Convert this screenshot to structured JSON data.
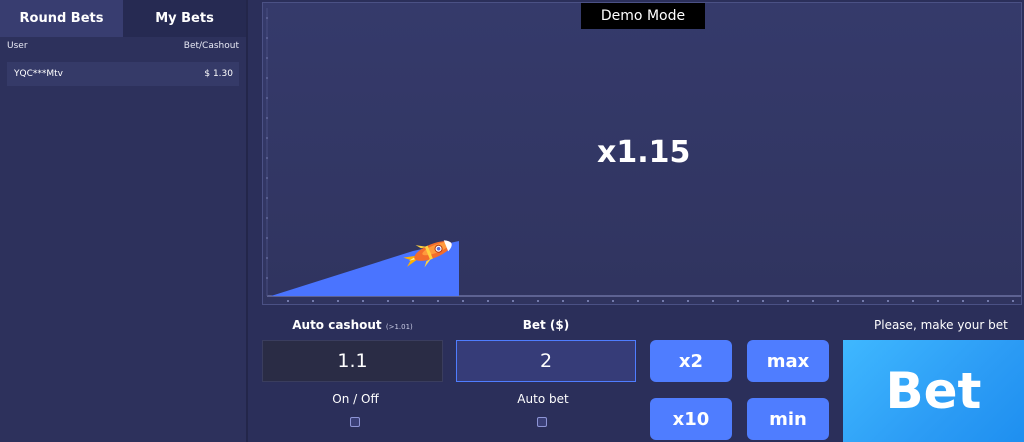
{
  "tabs": [
    {
      "label": "Round Bets",
      "active": true
    },
    {
      "label": "My Bets",
      "active": false
    }
  ],
  "bets_list": {
    "col_user": "User",
    "col_bet": "Bet/Cashout",
    "rows": [
      {
        "user": "YQC***Mtv",
        "amount": "$ 1.30"
      }
    ]
  },
  "game": {
    "demo_badge": "Demo Mode",
    "multiplier": "x1.15"
  },
  "controls": {
    "auto_cashout_label": "Auto cashout",
    "auto_cashout_hint": "(>1.01)",
    "auto_cashout_value": "1.1",
    "on_off_label": "On / Off",
    "bet_label": "Bet ($)",
    "bet_value": "2",
    "auto_bet_label": "Auto bet",
    "buttons": [
      "x2",
      "max",
      "x10",
      "min"
    ],
    "prompt": "Please, make your bet",
    "bet_button": "Bet"
  },
  "colors": {
    "background": "#2b2f5a",
    "accent": "#4f7dff",
    "bet_button": "#2c9cf5",
    "graph_fill": "#4a74ff"
  },
  "icons": {
    "rocket": "rocket-icon"
  }
}
